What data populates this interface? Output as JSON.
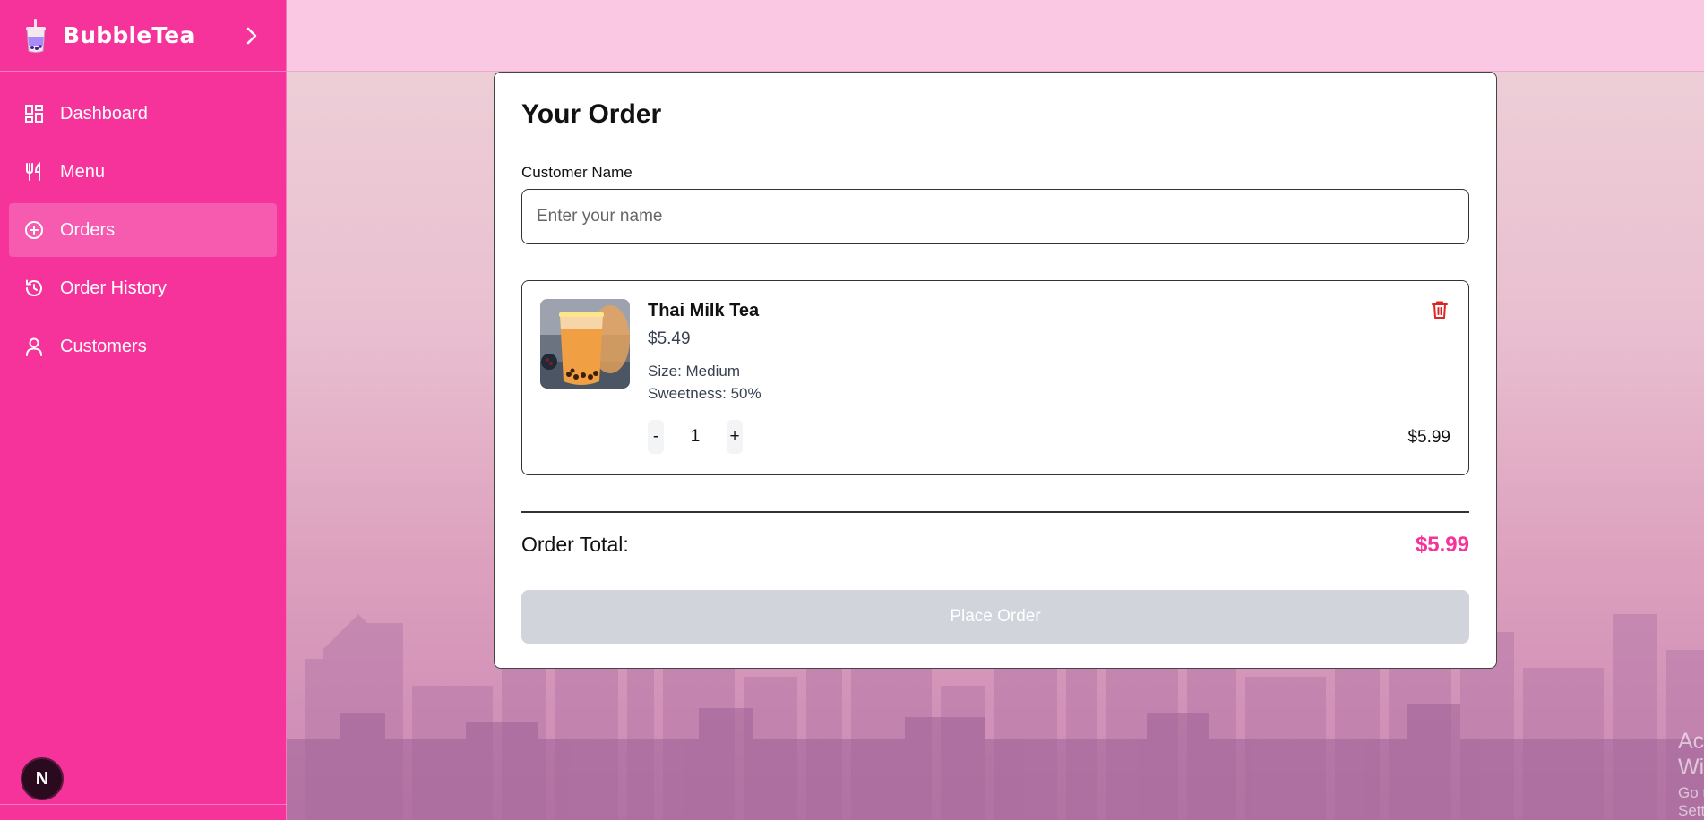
{
  "app": {
    "name": "BubbleTea"
  },
  "sidebar": {
    "items": [
      {
        "label": "Dashboard",
        "icon": "dashboard-icon"
      },
      {
        "label": "Menu",
        "icon": "utensils-icon"
      },
      {
        "label": "Orders",
        "icon": "plus-circle-icon",
        "active": true
      },
      {
        "label": "Order History",
        "icon": "history-icon"
      },
      {
        "label": "Customers",
        "icon": "user-icon"
      }
    ],
    "avatar_initial": "N"
  },
  "order": {
    "title": "Your Order",
    "customer_label": "Customer Name",
    "customer_placeholder": "Enter your name",
    "customer_value": "",
    "items": [
      {
        "name": "Thai Milk Tea",
        "price": "$5.49",
        "size": "Size: Medium",
        "sweetness": "Sweetness: 50%",
        "quantity": "1",
        "minus": "-",
        "plus": "+",
        "line_total": "$5.99"
      }
    ],
    "total_label": "Order Total:",
    "total_value": "$5.99",
    "place_button": "Place Order"
  },
  "watermark": {
    "line1": "Activate Windows",
    "line2": "Go to Settings to activate Windows."
  },
  "colors": {
    "brand": "#f5339b",
    "topbar": "#fbc8e3",
    "disabled_button": "#d1d5db",
    "delete": "#dc2626"
  }
}
